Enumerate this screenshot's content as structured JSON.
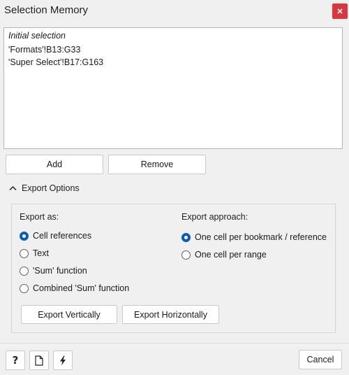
{
  "window": {
    "title": "Selection Memory"
  },
  "selection_list": {
    "items": [
      "Initial selection",
      "'Formats'!B13:G33",
      "'Super Select'!B17:G163"
    ]
  },
  "list_buttons": {
    "add_label": "Add",
    "remove_label": "Remove"
  },
  "export_options": {
    "expander_label": "Export Options",
    "expanded": true,
    "export_as": {
      "label": "Export as:",
      "options": [
        "Cell references",
        "Text",
        "'Sum' function",
        "Combined 'Sum' function"
      ],
      "selected": "Cell references"
    },
    "export_approach": {
      "label": "Export approach:",
      "options": [
        "One cell per bookmark / reference",
        "One cell per range"
      ],
      "selected": "One cell per bookmark / reference"
    },
    "export_vertically_label": "Export Vertically",
    "export_horizontally_label": "Export Horizontally"
  },
  "footer": {
    "icons": [
      "help-icon",
      "document-icon",
      "lightning-icon"
    ],
    "cancel_label": "Cancel"
  },
  "colors": {
    "close_button": "#d9363e",
    "radio_selected": "#0a5cb8"
  }
}
